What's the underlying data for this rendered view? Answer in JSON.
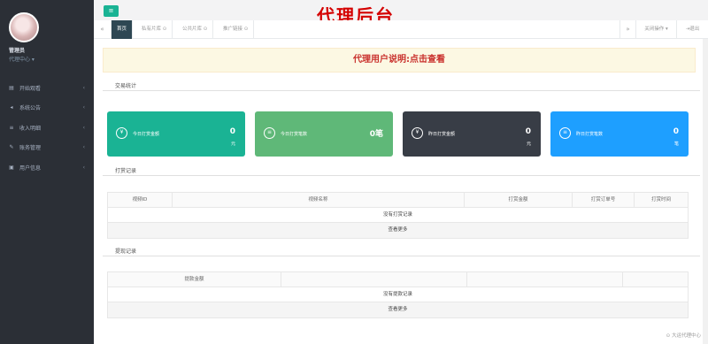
{
  "header": {
    "title": "代理后台",
    "menu_icon": "hamburger-icon"
  },
  "profile": {
    "name": "管理员",
    "role": "代理中心 ▾"
  },
  "sidebar": {
    "items": [
      {
        "label": "开始观看",
        "icon": "file-icon"
      },
      {
        "label": "系统公告",
        "icon": "bullhorn-icon"
      },
      {
        "label": "收入明细",
        "icon": "list-icon"
      },
      {
        "label": "账务管理",
        "icon": "edit-icon"
      },
      {
        "label": "用户信息",
        "icon": "user-icon"
      }
    ]
  },
  "tabs": {
    "items": [
      {
        "label": "首页",
        "active": true
      },
      {
        "label": "私有片库 ⊙",
        "active": false
      },
      {
        "label": "公共片库 ⊙",
        "active": false
      },
      {
        "label": "推广链接 ⊙",
        "active": false
      }
    ],
    "operations_label": "关闭操作 ▾",
    "logout_label": "⇥退出"
  },
  "notice": {
    "text": "代理用户说明:点击查看"
  },
  "sections": {
    "trade_stats": "交易统计",
    "reward_records": "打赏记录",
    "withdraw_records": "提现记录"
  },
  "stats": [
    {
      "label": "今日打赏金额",
      "value": "0",
      "unit": "元",
      "color": "#1ab394",
      "icon": "yen-icon"
    },
    {
      "label": "今日打赏笔数",
      "value": "0笔",
      "unit": "",
      "color": "#5fb878",
      "icon": "list-icon"
    },
    {
      "label": "昨日打赏金额",
      "value": "0",
      "unit": "元",
      "color": "#383d46",
      "icon": "yen-icon"
    },
    {
      "label": "昨日打赏笔数",
      "value": "0",
      "unit": "笔",
      "color": "#1e9fff",
      "icon": "list-icon"
    }
  ],
  "reward_table": {
    "headers": [
      "视频ID",
      "视频名称",
      "打赏金额",
      "打赏订单号",
      "打赏时间"
    ],
    "empty_text": "没有打赏记录",
    "more_text": "查看更多"
  },
  "withdraw_table": {
    "headers": [
      "提款金额",
      "",
      "",
      ""
    ],
    "empty_text": "没有提款记录",
    "more_text": "查看更多"
  },
  "footer": {
    "link": "⊙ 大运代理中心"
  }
}
